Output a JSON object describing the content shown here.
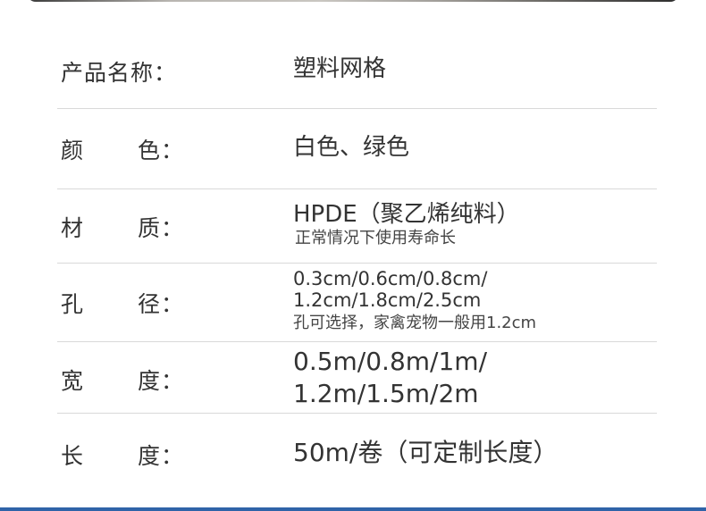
{
  "specs": {
    "name": {
      "label": "产品名称：",
      "value": "塑料网格"
    },
    "color": {
      "label_1": "颜",
      "label_2": "色：",
      "value": "白色、绿色"
    },
    "material": {
      "label_1": "材",
      "label_2": "质：",
      "value": "HPDE（聚乙烯纯料）",
      "note": "正常情况下使用寿命长"
    },
    "hole": {
      "label_1": "孔",
      "label_2": "径：",
      "line_1": "0.3cm/0.6cm/0.8cm/",
      "line_2": "1.2cm/1.8cm/2.5cm",
      "note": "孔可选择，家禽宠物一般用1.2cm"
    },
    "width": {
      "label_1": "宽",
      "label_2": "度：",
      "line_1": "0.5m/0.8m/1m/",
      "line_2": "1.2m/1.5m/2m"
    },
    "length": {
      "label_1": "长",
      "label_2": "度：",
      "value": "50m/卷（可定制长度）"
    }
  }
}
